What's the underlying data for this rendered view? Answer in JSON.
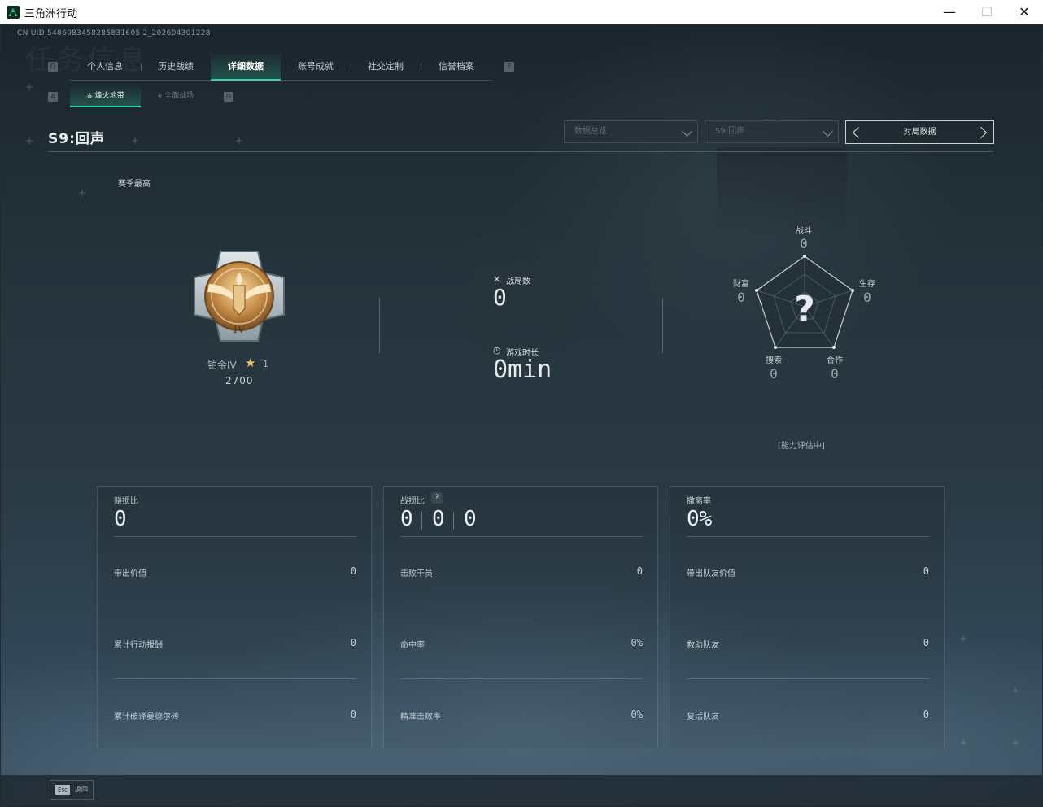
{
  "window": {
    "title": "三角洲行动",
    "minimize": "—",
    "maximize": "☐",
    "close": "✕"
  },
  "uid": "CN UID 5486083458285831605 2_202604301228",
  "ghost_title": "任务信息",
  "key_hints": {
    "left_main": "Q",
    "right_main": "E",
    "left_sub": "A",
    "right_sub": "D"
  },
  "main_tabs": [
    "个人信息",
    "历史战绩",
    "详细数据",
    "账号成就",
    "社交定制",
    "信誉档案"
  ],
  "active_main_tab": "详细数据",
  "sub_tabs": [
    {
      "label": "烽火地带",
      "icon": "⚶",
      "active": true
    },
    {
      "label": "全面战场",
      "icon": "⚹",
      "active": false
    }
  ],
  "season_title": "S9:回声",
  "dropdowns": [
    {
      "value": "数据总览"
    },
    {
      "value": "S9:回声"
    }
  ],
  "pager": {
    "label": "对局数据"
  },
  "season_high_label": "赛季最高",
  "rank": {
    "name": "铂金IV",
    "numeral": "IV",
    "stars": "1",
    "score": "2700"
  },
  "stats": {
    "matches": {
      "label": "战局数",
      "value": "0",
      "icon": "✕"
    },
    "playtime": {
      "label": "游戏时长",
      "value": "0min",
      "icon": "◷"
    }
  },
  "radar": {
    "center": "?",
    "axes": [
      {
        "label": "战斗",
        "value": "0"
      },
      {
        "label": "生存",
        "value": "0"
      },
      {
        "label": "合作",
        "value": "0"
      },
      {
        "label": "搜索",
        "value": "0"
      },
      {
        "label": "财富",
        "value": "0"
      }
    ],
    "status": "[能力评估中]"
  },
  "cards": [
    {
      "title": "赚损比",
      "big": "0",
      "rows": [
        {
          "label": "带出价值",
          "value": "0"
        },
        {
          "label": "累计行动报酬",
          "value": "0"
        },
        {
          "label": "累计破译曼德尔砖",
          "value": "0"
        }
      ]
    },
    {
      "title": "战损比",
      "help": "?",
      "ratio": [
        "0",
        "0",
        "0"
      ],
      "rows": [
        {
          "label": "击败干员",
          "value": "0"
        },
        {
          "label": "命中率",
          "value": "0%"
        },
        {
          "label": "精准击败率",
          "value": "0%"
        }
      ]
    },
    {
      "title": "撤离率",
      "big": "0%",
      "rows": [
        {
          "label": "带出队友价值",
          "value": "0"
        },
        {
          "label": "救助队友",
          "value": "0"
        },
        {
          "label": "复活队友",
          "value": "0"
        }
      ]
    }
  ],
  "footer": {
    "esc_key": "Esc",
    "esc_label": "返回"
  },
  "colors": {
    "accent": "#38d3a4",
    "gold": "#e6c46a",
    "background": "#1f2a33"
  }
}
